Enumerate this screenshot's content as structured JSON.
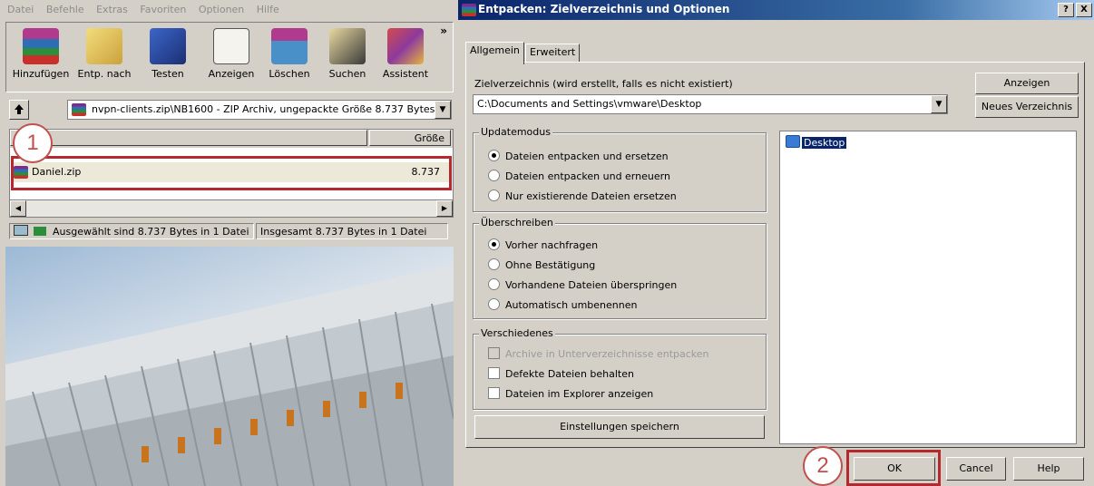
{
  "left": {
    "menu": [
      "Datei",
      "Befehle",
      "Extras",
      "Favoriten",
      "Optionen",
      "Hilfe"
    ],
    "toolbar": {
      "buttons": [
        {
          "label": "Hinzufügen",
          "icon": "books-add-icon",
          "color": "#c0392b"
        },
        {
          "label": "Entp. nach",
          "icon": "folder-extract-icon",
          "color": "#d9b44a"
        },
        {
          "label": "Testen",
          "icon": "book-check-icon",
          "color": "#2b4fa8"
        },
        {
          "label": "Anzeigen",
          "icon": "glasses-view-icon",
          "color": "#6b6b6b"
        },
        {
          "label": "Löschen",
          "icon": "trash-books-icon",
          "color": "#2a6aa0"
        },
        {
          "label": "Suchen",
          "icon": "binoculars-icon",
          "color": "#333333"
        },
        {
          "label": "Assistent",
          "icon": "wizard-icon",
          "color": "#8e3a9d"
        }
      ],
      "more": "»"
    },
    "path": "nvpn-clients.zip\\NB1600 - ZIP Archiv, ungepackte Größe 8.737 Bytes",
    "columns": {
      "size": "Größe"
    },
    "files": [
      {
        "name": "Daniel.zip",
        "size": "8.737"
      }
    ],
    "status": {
      "selected": "Ausgewählt sind 8.737 Bytes in 1 Datei",
      "total": "Insgesamt 8.737 Bytes in 1 Datei"
    },
    "callout": "1"
  },
  "dialog": {
    "title": "Entpacken: Zielverzeichnis und Optionen",
    "title_buttons": [
      "?",
      "X"
    ],
    "tabs": [
      "Allgemein",
      "Erweitert"
    ],
    "target_label": "Zielverzeichnis (wird erstellt, falls es nicht existiert)",
    "target_path": "C:\\Documents and Settings\\vmware\\Desktop",
    "buttons": {
      "show": "Anzeigen",
      "new_folder": "Neues Verzeichnis",
      "save_settings": "Einstellungen speichern",
      "ok": "OK",
      "cancel": "Cancel",
      "help": "Help"
    },
    "update_mode": {
      "title": "Updatemodus",
      "options": [
        "Dateien entpacken und ersetzen",
        "Dateien entpacken und erneuern",
        "Nur existierende Dateien ersetzen"
      ],
      "selected_index": 0
    },
    "overwrite": {
      "title": "Überschreiben",
      "options": [
        "Vorher nachfragen",
        "Ohne Bestätigung",
        "Vorhandene Dateien überspringen",
        "Automatisch umbenennen"
      ],
      "selected_index": 0
    },
    "misc": {
      "title": "Verschiedenes",
      "options": [
        "Archive in Unterverzeichnisse entpacken",
        "Defekte Dateien behalten",
        "Dateien im Explorer anzeigen"
      ]
    },
    "tree": {
      "item": "Desktop"
    },
    "callout": "2"
  }
}
